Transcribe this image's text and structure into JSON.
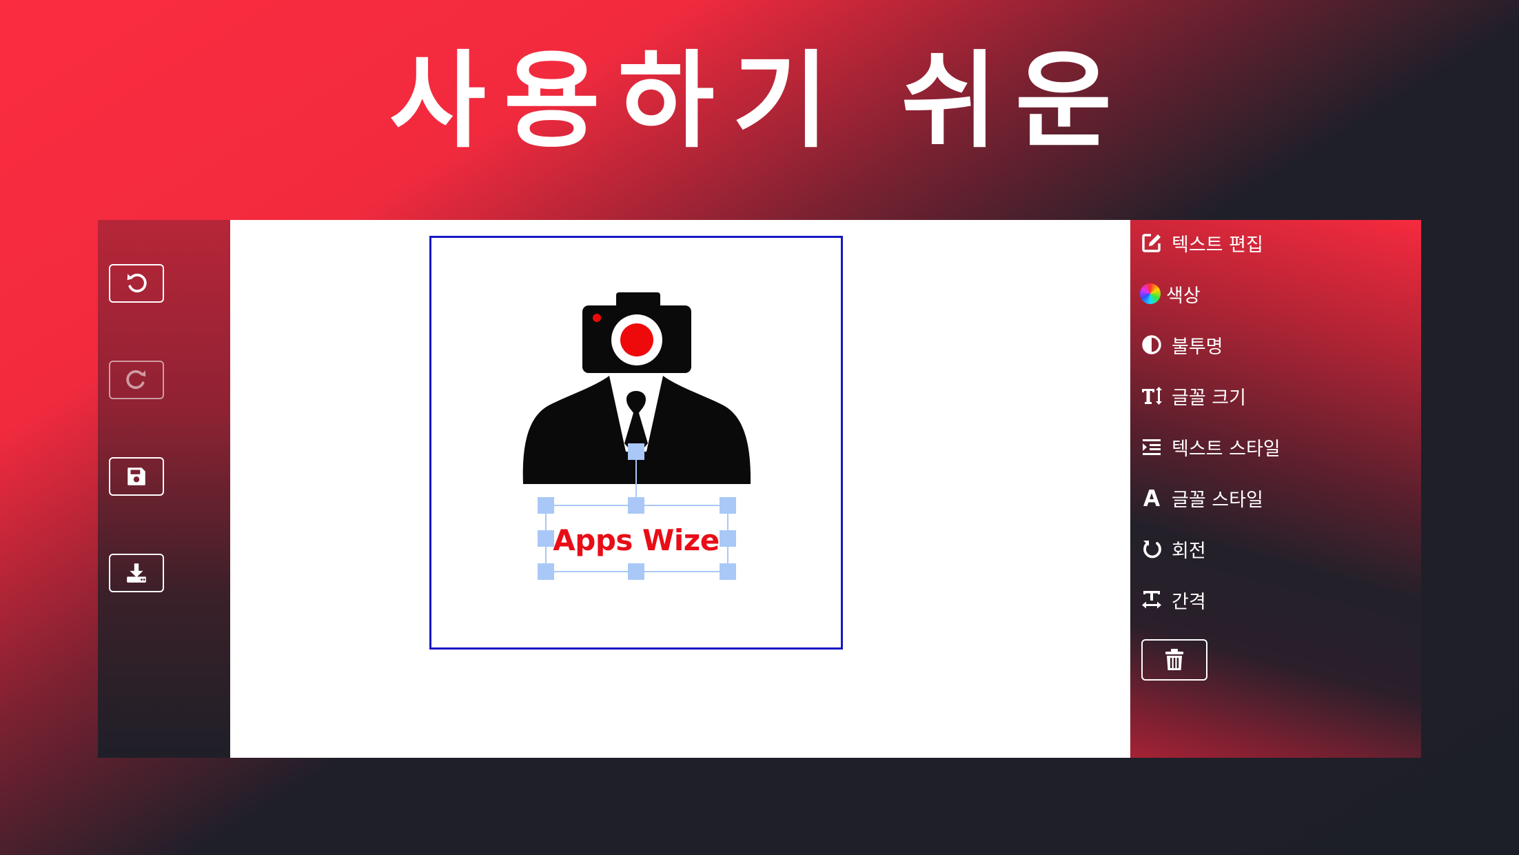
{
  "headline": "사용하기 쉬운",
  "toolbar": {
    "undo": "undo-icon",
    "redo": "redo-icon",
    "save": "save-icon",
    "download": "download-icon"
  },
  "canvas": {
    "text_object": "Apps Wize",
    "text_color": "#e80d17",
    "frame_border_color": "#1717c4",
    "selection_color": "#a9c8f7"
  },
  "menu": {
    "items": [
      {
        "label": "텍스트 편집",
        "icon": "edit-icon"
      },
      {
        "label": "색상",
        "icon": "color-wheel-icon"
      },
      {
        "label": "불투명",
        "icon": "opacity-icon"
      },
      {
        "label": "글꼴 크기",
        "icon": "text-height-icon"
      },
      {
        "label": "텍스트 스타일",
        "icon": "indent-icon"
      },
      {
        "label": "글꼴 스타일",
        "icon": "font-icon"
      },
      {
        "label": "회전",
        "icon": "rotate-icon"
      },
      {
        "label": "간격",
        "icon": "text-width-icon"
      }
    ],
    "delete": "trash-icon"
  },
  "colors": {
    "brand_red": "#fb2c40",
    "dark_bg": "#1d1f28"
  }
}
